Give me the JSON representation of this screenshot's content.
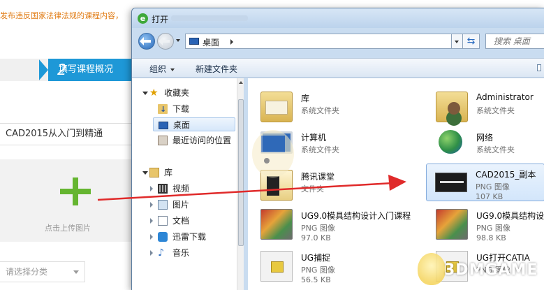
{
  "background_page": {
    "notice": "发布违反国家法律法规的课程内容，",
    "step": {
      "number": "2",
      "label": "填写课程概况"
    },
    "course_title": "CAD2015从入门到精通",
    "upload_label": "点击上传图片",
    "category_placeholder": "请选择分类"
  },
  "dialog": {
    "title": "打开",
    "address": {
      "crumb": "桌面"
    },
    "search_placeholder": "搜索 桌面",
    "toolbar": {
      "organize": "组织",
      "new_folder": "新建文件夹"
    },
    "nav": {
      "favorites": "收藏夹",
      "downloads": "下载",
      "desktop": "桌面",
      "recent": "最近访问的位置",
      "libraries": "库",
      "videos": "视频",
      "pictures": "图片",
      "documents": "文档",
      "xunlei": "迅雷下载",
      "music": "音乐"
    },
    "files": [
      {
        "name": "库",
        "line1": "系统文件夹",
        "line2": "",
        "icon": "libraries-folder-icon"
      },
      {
        "name": "Administrator",
        "line1": "系统文件夹",
        "line2": "",
        "icon": "user-folder-icon"
      },
      {
        "name": "计算机",
        "line1": "系统文件夹",
        "line2": "",
        "icon": "computer-icon"
      },
      {
        "name": "网络",
        "line1": "系统文件夹",
        "line2": "",
        "icon": "network-icon"
      },
      {
        "name": "腾讯课堂",
        "line1": "文件夹",
        "line2": "",
        "icon": "folder-icon"
      },
      {
        "name": "CAD2015_副本",
        "line1": "PNG 图像",
        "line2": "107 KB",
        "icon": "png-thumbnail"
      },
      {
        "name": "UG9.0模具结构设计入门课程",
        "line1": "PNG 图像",
        "line2": "97.0 KB",
        "icon": "png-thumbnail"
      },
      {
        "name": "UG9.0模具结构设计",
        "line1": "PNG 图像",
        "line2": "98.8 KB",
        "icon": "png-thumbnail"
      },
      {
        "name": "UG捕捉",
        "line1": "PNG 图像",
        "line2": "56.5 KB",
        "icon": "png-thumbnail"
      },
      {
        "name": "UG打开CATIA",
        "line1": "PNG 图像",
        "line2": "",
        "icon": "png-thumbnail"
      }
    ]
  },
  "watermark": "3DMGAME",
  "colors": {
    "accent": "#1e98d7",
    "plus": "#65b530",
    "arrow": "#e02a2a",
    "dialog_frame": "#c9dcf0"
  }
}
